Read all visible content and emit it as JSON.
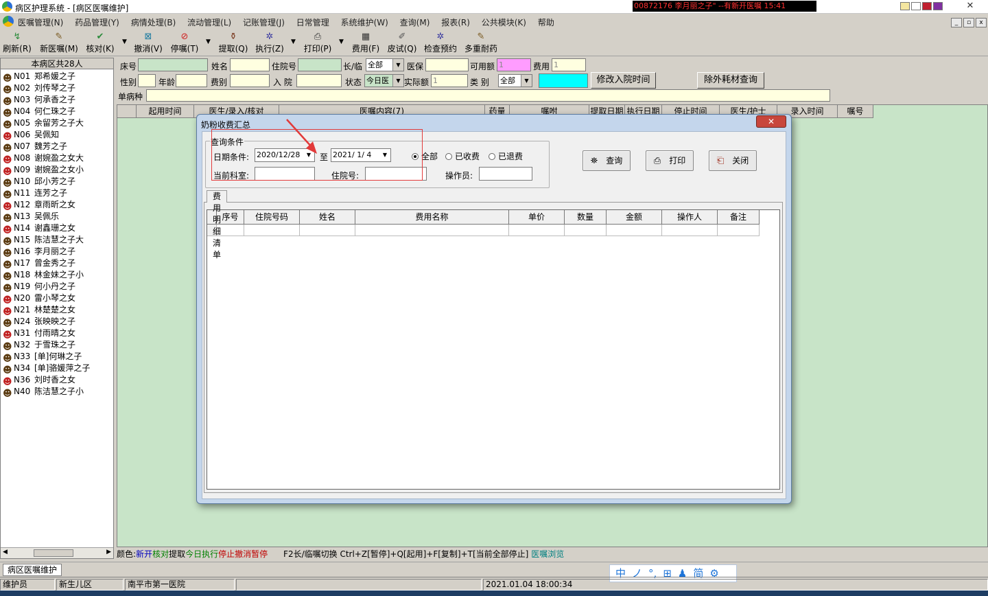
{
  "window": {
    "title": "病区护理系统 - [病区医嘱维护]",
    "ticker": "00872176  李月丽之子\" --有新开医嘱  15:41",
    "close_glyph": "✕"
  },
  "menu": [
    "医嘱管理(N)",
    "药品管理(Y)",
    "病情处理(B)",
    "流动管理(L)",
    "记账管理(J)",
    "日常管理",
    "系统维护(W)",
    "查询(M)",
    "报表(R)",
    "公共模块(K)",
    "帮助"
  ],
  "toolbar": {
    "refresh": "刷新(R)",
    "new_order": "新医嘱(M)",
    "verify": "核对(K)",
    "cancel": "撤消(V)",
    "stop": "停嘱(T)",
    "fetch": "提取(Q)",
    "execute": "执行(Z)",
    "print": "打印(P)",
    "fee": "费用(F)",
    "skin_test": "皮试(Q)",
    "exam_booking": "检查预约",
    "multi_resist": "多重耐药"
  },
  "patients": {
    "header": "本病区共28人",
    "items": [
      {
        "bed": "N01",
        "name": "郑希媛之子",
        "gender": "m"
      },
      {
        "bed": "N02",
        "name": "刘传琴之子",
        "gender": "m"
      },
      {
        "bed": "N03",
        "name": "何承香之子",
        "gender": "m"
      },
      {
        "bed": "N04",
        "name": "何仁珠之子",
        "gender": "m"
      },
      {
        "bed": "N05",
        "name": "余留芳之子大",
        "gender": "m"
      },
      {
        "bed": "N06",
        "name": "吴佩知",
        "gender": "f"
      },
      {
        "bed": "N07",
        "name": "魏芳之子",
        "gender": "m"
      },
      {
        "bed": "N08",
        "name": "谢婉盈之女大",
        "gender": "f"
      },
      {
        "bed": "N09",
        "name": "谢婉盈之女小",
        "gender": "f"
      },
      {
        "bed": "N10",
        "name": "邱小芳之子",
        "gender": "m"
      },
      {
        "bed": "N11",
        "name": "连芳之子",
        "gender": "m"
      },
      {
        "bed": "N12",
        "name": "章雨昕之女",
        "gender": "f"
      },
      {
        "bed": "N13",
        "name": "吴佩乐",
        "gender": "m"
      },
      {
        "bed": "N14",
        "name": "谢鑫珊之女",
        "gender": "f"
      },
      {
        "bed": "N15",
        "name": "陈洁慧之子大",
        "gender": "m"
      },
      {
        "bed": "N16",
        "name": "李月丽之子",
        "gender": "m"
      },
      {
        "bed": "N17",
        "name": "曾金秀之子",
        "gender": "m"
      },
      {
        "bed": "N18",
        "name": "林金妹之子小",
        "gender": "m"
      },
      {
        "bed": "N19",
        "name": "何小丹之子",
        "gender": "m"
      },
      {
        "bed": "N20",
        "name": "雷小琴之女",
        "gender": "f"
      },
      {
        "bed": "N21",
        "name": "林楚楚之女",
        "gender": "f"
      },
      {
        "bed": "N24",
        "name": "张映映之子",
        "gender": "m"
      },
      {
        "bed": "N31",
        "name": "付雨晴之女",
        "gender": "f"
      },
      {
        "bed": "N32",
        "name": "于雪珠之子",
        "gender": "m"
      },
      {
        "bed": "N33",
        "name": "[单]何琳之子",
        "gender": "m"
      },
      {
        "bed": "N34",
        "name": "[单]骆媛萍之子",
        "gender": "m"
      },
      {
        "bed": "N36",
        "name": "刘时香之女",
        "gender": "f"
      },
      {
        "bed": "N40",
        "name": "陈洁慧之子小",
        "gender": "m"
      }
    ]
  },
  "filters": {
    "bed_no": "床号",
    "name": "姓名",
    "inpatient_no": "住院号",
    "long_temp": "长/临",
    "long_temp_value": "全部",
    "insurance": "医保",
    "available": "可用额",
    "available_value": "1",
    "fee": "费用",
    "fee_value": "1",
    "gender": "性别",
    "age": "年龄",
    "fee_type": "费别",
    "admit": "入  院",
    "status": "状态",
    "status_value": "今日医",
    "actual": "实际额",
    "actual_value": "1",
    "category": "类    别",
    "category_value": "全部",
    "modify_admit_btn": "修改入院时间",
    "extra_consumables_btn": "除外耗材查询",
    "single_disease": "单病种"
  },
  "order_grid": {
    "columns": [
      "",
      "起用时间",
      "医生/录入/核对",
      "医嘱内容(7)",
      "药量",
      "嘱咐",
      "提取日期",
      "执行日期",
      "停止时间",
      "医生/护士",
      "录入时间",
      "嘱号"
    ]
  },
  "legend": {
    "prefix": "颜色:",
    "items": [
      {
        "text": "新开",
        "color": "#0000c0"
      },
      {
        "text": "核对",
        "color": "#008000"
      },
      {
        "text": "提取",
        "color": "#000000"
      },
      {
        "text": "今日执行",
        "color": "#008000"
      },
      {
        "text": "停止",
        "color": "#c00000"
      },
      {
        "text": "撤消",
        "color": "#c00000"
      },
      {
        "text": "暂停",
        "color": "#c00000"
      }
    ],
    "hint": "F2长/临嘱切换   Ctrl+Z[暂停]+Q[起用]+F[复制]+T[当前全部停止]",
    "browse": "医嘱浏览"
  },
  "task_tab": "病区医嘱维护",
  "ime": [
    "中",
    "ノ",
    "°,",
    "⊞",
    "♟",
    "简",
    "⚙"
  ],
  "status": {
    "role": "维护员",
    "ward": "新生儿区",
    "hospital": "南平市第一医院",
    "datetime": "2021.01.04 18:00:34"
  },
  "dialog": {
    "title": "奶粉收费汇总",
    "close_glyph": "✕",
    "query_group": "查询条件",
    "date_label": "日期条件:",
    "date_from": "2020/12/28",
    "to_label": "至",
    "date_to": "2021/ 1/ 4",
    "radios": [
      {
        "label": "全部",
        "checked": true
      },
      {
        "label": "已收费",
        "checked": false
      },
      {
        "label": "已退费",
        "checked": false
      }
    ],
    "dept_label": "当前科室:",
    "inpatient_label": "住院号:",
    "operator_label": "操作员:",
    "btn_query": "查询",
    "btn_print": "打印",
    "btn_close": "关闭",
    "tab_label": "费用明细清单",
    "columns": [
      "",
      "序号",
      "住院号码",
      "姓名",
      "费用名称",
      "单价",
      "数量",
      "金额",
      "操作人",
      "备注"
    ]
  },
  "annotation_color": "#e23a3a"
}
